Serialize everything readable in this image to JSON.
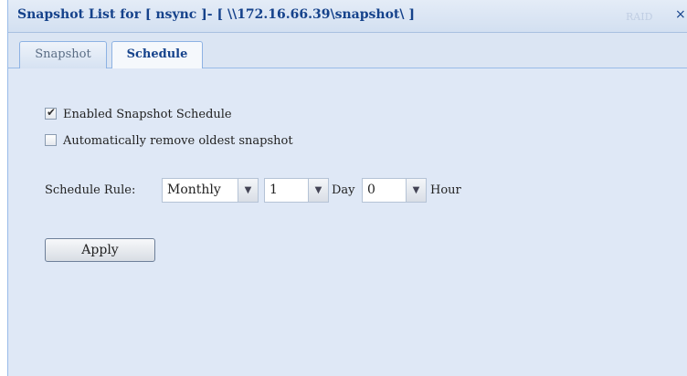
{
  "window": {
    "title": "Snapshot List for [ nsync ]- [ \\\\172.16.66.39\\snapshot\\ ]",
    "watermark": "RAID",
    "close_symbol": "×"
  },
  "tabs": [
    {
      "label": "Snapshot",
      "active": false
    },
    {
      "label": "Schedule",
      "active": true
    }
  ],
  "schedule": {
    "enable_label": "Enabled Snapshot Schedule",
    "enable_checked": true,
    "auto_remove_label": "Automatically remove oldest snapshot",
    "auto_remove_checked": false,
    "rule_label": "Schedule Rule:",
    "frequency": "Monthly",
    "day_value": "1",
    "day_unit": "Day",
    "hour_value": "0",
    "hour_unit": "Hour",
    "dropdown_arrow": "▼",
    "apply_label": "Apply"
  }
}
